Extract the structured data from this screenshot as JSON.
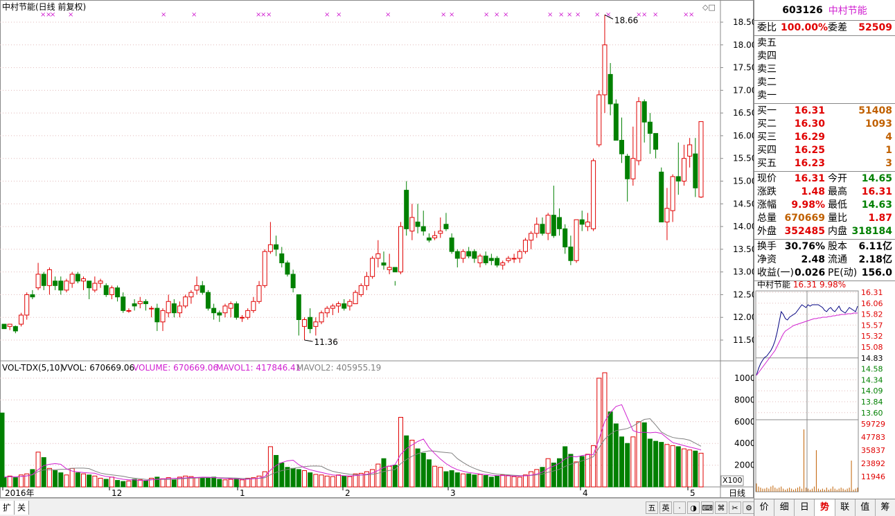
{
  "header": {
    "title": "中村节能(日线 前复权)"
  },
  "candles": [
    [
      11.85,
      11.85,
      11.75,
      11.75
    ],
    [
      11.8,
      11.85,
      11.72,
      11.85
    ],
    [
      11.8,
      11.82,
      11.65,
      11.7
    ],
    [
      11.85,
      12.1,
      11.8,
      12.05
    ],
    [
      12.05,
      12.55,
      11.95,
      12.5
    ],
    [
      12.5,
      12.6,
      12.4,
      12.45
    ],
    [
      12.65,
      13.2,
      12.6,
      12.95
    ],
    [
      12.95,
      13.0,
      12.6,
      12.7
    ],
    [
      12.7,
      13.1,
      12.5,
      13.05
    ],
    [
      12.7,
      12.9,
      12.6,
      12.8
    ],
    [
      12.8,
      12.9,
      12.5,
      12.6
    ],
    [
      12.6,
      12.85,
      12.55,
      12.8
    ],
    [
      12.75,
      13.0,
      12.65,
      12.95
    ],
    [
      12.95,
      13.0,
      12.75,
      12.8
    ],
    [
      12.8,
      12.9,
      12.6,
      12.85
    ],
    [
      12.8,
      12.8,
      12.4,
      12.65
    ],
    [
      12.6,
      12.9,
      12.55,
      12.75
    ],
    [
      12.75,
      12.85,
      12.65,
      12.8
    ],
    [
      12.7,
      12.75,
      12.45,
      12.5
    ],
    [
      12.5,
      12.7,
      12.4,
      12.65
    ],
    [
      12.65,
      12.7,
      12.35,
      12.45
    ],
    [
      12.45,
      12.55,
      12.1,
      12.15
    ],
    [
      12.15,
      12.2,
      12.1,
      12.15
    ],
    [
      12.3,
      12.4,
      12.15,
      12.25
    ],
    [
      12.3,
      12.45,
      12.2,
      12.35
    ],
    [
      12.35,
      12.4,
      12.15,
      12.3
    ],
    [
      12.2,
      12.25,
      12.0,
      12.2
    ],
    [
      12.2,
      12.3,
      11.7,
      11.9
    ],
    [
      11.9,
      12.2,
      11.7,
      12.15
    ],
    [
      12.1,
      12.5,
      12.0,
      12.35
    ],
    [
      12.3,
      12.4,
      12.0,
      12.1
    ],
    [
      12.1,
      12.35,
      12.0,
      12.25
    ],
    [
      12.25,
      12.5,
      12.2,
      12.45
    ],
    [
      12.45,
      12.6,
      12.3,
      12.55
    ],
    [
      12.6,
      12.9,
      12.5,
      12.7
    ],
    [
      12.7,
      12.8,
      12.5,
      12.55
    ],
    [
      12.55,
      12.6,
      12.15,
      12.2
    ],
    [
      12.2,
      12.3,
      11.95,
      12.1
    ],
    [
      12.1,
      12.15,
      11.9,
      12.05
    ],
    [
      12.1,
      12.3,
      12.0,
      12.25
    ],
    [
      12.2,
      12.35,
      12.0,
      12.3
    ],
    [
      12.3,
      12.35,
      11.95,
      12.0
    ],
    [
      12.0,
      12.05,
      11.9,
      12.0
    ],
    [
      12.0,
      12.2,
      11.95,
      12.15
    ],
    [
      12.15,
      12.45,
      12.1,
      12.35
    ],
    [
      12.35,
      12.8,
      12.3,
      12.7
    ],
    [
      12.7,
      13.5,
      12.65,
      13.45
    ],
    [
      13.45,
      14.1,
      13.4,
      13.6
    ],
    [
      13.6,
      13.8,
      13.35,
      13.5
    ],
    [
      13.4,
      13.55,
      13.1,
      13.2
    ],
    [
      13.2,
      13.25,
      12.9,
      12.95
    ],
    [
      12.95,
      13.05,
      12.55,
      12.65
    ],
    [
      12.5,
      12.5,
      11.6,
      11.95
    ],
    [
      11.8,
      12.0,
      11.5,
      11.95
    ],
    [
      12.0,
      12.2,
      11.65,
      11.75
    ],
    [
      11.8,
      12.0,
      11.6,
      11.9
    ],
    [
      11.9,
      12.15,
      11.85,
      12.1
    ],
    [
      12.1,
      12.25,
      12.0,
      12.2
    ],
    [
      12.2,
      12.3,
      12.05,
      12.25
    ],
    [
      12.25,
      12.35,
      12.1,
      12.3
    ],
    [
      12.3,
      12.4,
      12.15,
      12.2
    ],
    [
      12.25,
      12.4,
      12.15,
      12.35
    ],
    [
      12.3,
      12.6,
      12.3,
      12.55
    ],
    [
      12.5,
      12.75,
      12.45,
      12.7
    ],
    [
      12.7,
      13.0,
      12.6,
      12.9
    ],
    [
      12.9,
      13.35,
      12.85,
      13.3
    ],
    [
      13.3,
      13.7,
      13.1,
      13.4
    ],
    [
      13.2,
      13.45,
      13.05,
      13.15
    ],
    [
      13.05,
      13.4,
      12.95,
      13.1
    ],
    [
      13.1,
      12.8,
      12.7,
      13.0
    ],
    [
      13.0,
      14.1,
      12.95,
      14.0
    ],
    [
      14.8,
      15.0,
      13.8,
      13.95
    ],
    [
      13.9,
      14.5,
      13.7,
      14.2
    ],
    [
      14.1,
      14.5,
      13.85,
      14.0
    ],
    [
      14.0,
      14.35,
      13.8,
      13.9
    ],
    [
      13.75,
      13.85,
      13.65,
      13.7
    ],
    [
      13.75,
      13.9,
      13.7,
      13.8
    ],
    [
      13.85,
      14.2,
      13.75,
      13.9
    ],
    [
      14.05,
      14.3,
      13.9,
      13.95
    ],
    [
      13.75,
      13.85,
      13.4,
      13.45
    ],
    [
      13.45,
      13.5,
      13.1,
      13.3
    ],
    [
      13.3,
      13.5,
      13.2,
      13.45
    ],
    [
      13.45,
      13.55,
      13.3,
      13.35
    ],
    [
      13.45,
      13.5,
      13.2,
      13.3
    ],
    [
      13.2,
      13.4,
      13.1,
      13.35
    ],
    [
      13.35,
      13.45,
      13.15,
      13.2
    ],
    [
      13.3,
      13.4,
      13.15,
      13.25
    ],
    [
      13.3,
      13.35,
      13.1,
      13.15
    ],
    [
      13.15,
      13.25,
      13.05,
      13.2
    ],
    [
      13.25,
      13.35,
      13.2,
      13.3
    ],
    [
      13.3,
      13.4,
      13.2,
      13.3
    ],
    [
      13.3,
      13.5,
      13.2,
      13.45
    ],
    [
      13.45,
      13.75,
      13.4,
      13.7
    ],
    [
      13.7,
      13.9,
      13.5,
      13.85
    ],
    [
      13.85,
      14.2,
      13.75,
      14.05
    ],
    [
      14.05,
      14.2,
      13.8,
      13.85
    ],
    [
      13.85,
      14.3,
      13.7,
      14.25
    ],
    [
      14.25,
      14.9,
      13.75,
      13.8
    ],
    [
      14.2,
      14.4,
      13.8,
      13.95
    ],
    [
      13.95,
      14.05,
      13.4,
      13.55
    ],
    [
      13.55,
      13.8,
      13.15,
      13.25
    ],
    [
      13.25,
      14.0,
      13.2,
      14.15
    ],
    [
      14.15,
      14.35,
      13.9,
      14.05
    ],
    [
      14.0,
      14.3,
      13.9,
      14.1
    ],
    [
      13.95,
      15.5,
      13.9,
      15.45
    ],
    [
      15.8,
      17.0,
      15.75,
      16.9
    ],
    [
      16.9,
      18.66,
      16.5,
      18.0
    ],
    [
      17.35,
      17.6,
      16.45,
      16.7
    ],
    [
      16.7,
      16.8,
      16.1,
      15.9
    ],
    [
      15.9,
      16.4,
      15.4,
      15.6
    ],
    [
      15.55,
      15.6,
      14.55,
      15.05
    ],
    [
      15.05,
      16.2,
      14.9,
      15.5
    ],
    [
      15.45,
      16.85,
      15.35,
      16.75
    ],
    [
      16.75,
      16.8,
      15.85,
      16.3
    ],
    [
      16.3,
      16.5,
      15.6,
      16.05
    ],
    [
      16.05,
      16.0,
      15.5,
      15.7
    ],
    [
      15.2,
      15.3,
      14.1,
      14.1
    ],
    [
      14.1,
      14.85,
      13.7,
      14.4
    ],
    [
      14.35,
      15.15,
      14.1,
      15.1
    ],
    [
      15.1,
      15.85,
      14.7,
      15.0
    ],
    [
      15.0,
      15.8,
      14.9,
      15.5
    ],
    [
      15.55,
      15.95,
      15.3,
      15.8
    ],
    [
      15.6,
      15.95,
      14.65,
      14.85
    ],
    [
      14.65,
      16.31,
      14.63,
      16.31
    ]
  ],
  "candle_up": [
    0,
    1,
    0,
    1,
    1,
    0,
    1,
    0,
    1,
    0,
    0,
    1,
    1,
    0,
    1,
    0,
    1,
    1,
    0,
    1,
    0,
    0,
    1,
    0,
    1,
    0,
    1,
    0,
    1,
    1,
    0,
    1,
    1,
    1,
    1,
    0,
    0,
    0,
    0,
    1,
    1,
    0,
    1,
    1,
    1,
    1,
    1,
    1,
    0,
    0,
    0,
    0,
    0,
    1,
    0,
    1,
    1,
    1,
    1,
    1,
    0,
    1,
    1,
    1,
    1,
    1,
    1,
    0,
    1,
    0,
    1,
    0,
    1,
    0,
    0,
    0,
    1,
    1,
    0,
    0,
    0,
    1,
    0,
    0,
    1,
    0,
    0,
    0,
    1,
    1,
    1,
    1,
    1,
    1,
    1,
    0,
    1,
    0,
    0,
    0,
    0,
    1,
    0,
    1,
    1,
    1,
    1,
    0,
    0,
    0,
    0,
    1,
    1,
    0,
    0,
    0,
    0,
    1,
    1,
    0,
    1,
    1,
    0,
    1
  ],
  "volumes": [
    900,
    1000,
    850,
    1100,
    1200,
    1600,
    3200,
    2700,
    1700,
    1500,
    1300,
    1100,
    1700,
    1300,
    1200,
    1100,
    1000,
    800,
    700,
    900,
    600,
    500,
    550,
    700,
    650,
    550,
    800,
    900,
    750,
    850,
    650,
    900,
    1000,
    950,
    850,
    800,
    850,
    900,
    700,
    650,
    700,
    750,
    650,
    800,
    850,
    1000,
    1400,
    3700,
    2900,
    2200,
    1800,
    1700,
    1600,
    1500,
    1300,
    1150,
    1100,
    1000,
    950,
    1100,
    1000,
    950,
    1200,
    1250,
    1400,
    1600,
    2100,
    2600,
    1900,
    2000,
    6400,
    4700,
    4300,
    3500,
    3100,
    2500,
    1900,
    1800,
    1400,
    1500,
    1300,
    1200,
    1200,
    1100,
    1150,
    1050,
    900,
    1000,
    1100,
    1050,
    950,
    900,
    1100,
    1400,
    1600,
    1800,
    2600,
    2200,
    2600,
    3700,
    3000,
    2300,
    2800,
    3000,
    3800,
    10000,
    10500,
    6900,
    5800,
    4600,
    4000,
    4600,
    6000,
    5900,
    4400,
    4200,
    4100,
    3900,
    3800,
    3700,
    3500,
    3400,
    3300,
    3100,
    6800
  ],
  "price_axis": {
    "labels": [
      "18.50",
      "18.00",
      "17.50",
      "17.00",
      "16.50",
      "16.00",
      "15.50",
      "15.00",
      "14.50",
      "14.00",
      "13.50",
      "13.00",
      "12.50",
      "12.00",
      "11.50"
    ]
  },
  "volume_axis": {
    "labels": [
      "10000",
      "8000",
      "6000",
      "4000",
      "2000"
    ],
    "multiplier": "X100"
  },
  "date_axis": {
    "labels": [
      "2016年",
      "12",
      "1",
      "2",
      "3",
      "4",
      "5"
    ],
    "period": "日线"
  },
  "annotations": {
    "high": "18.66",
    "low": "11.36"
  },
  "indicator": {
    "name": "VOL-TDX(5,10)",
    "vvol": "VVOL: 670669.06",
    "volume": "VOLUME: 670669.06",
    "mavol1": "MAVOL1: 417846.41",
    "mavol2": "MAVOL2: 405955.19"
  },
  "bottom_tabs": [
    "扩展八",
    "关联报价"
  ],
  "ime_icons": [
    "五",
    "英",
    "·",
    "◑",
    "⌨",
    "⌘",
    "✂",
    "⚙",
    "▦"
  ],
  "quote": {
    "code": "603126",
    "name": "中村节能",
    "ratio": {
      "l1": "委比",
      "v1": "100.00%",
      "l2": "委差",
      "v2": "52509"
    },
    "sell": [
      {
        "label": "卖五",
        "price": "",
        "vol": ""
      },
      {
        "label": "卖四",
        "price": "",
        "vol": ""
      },
      {
        "label": "卖三",
        "price": "",
        "vol": ""
      },
      {
        "label": "卖二",
        "price": "",
        "vol": ""
      },
      {
        "label": "卖一",
        "price": "",
        "vol": ""
      }
    ],
    "buy": [
      {
        "label": "买一",
        "price": "16.31",
        "vol": "51408"
      },
      {
        "label": "买二",
        "price": "16.30",
        "vol": "1093"
      },
      {
        "label": "买三",
        "price": "16.29",
        "vol": "4"
      },
      {
        "label": "买四",
        "price": "16.25",
        "vol": "1"
      },
      {
        "label": "买五",
        "price": "16.23",
        "vol": "3"
      }
    ],
    "stats": [
      {
        "l1": "现价",
        "v1": "16.31",
        "c1": "red",
        "l2": "今开",
        "v2": "14.65",
        "c2": "green"
      },
      {
        "l1": "涨跌",
        "v1": "1.48",
        "c1": "red",
        "l2": "最高",
        "v2": "16.31",
        "c2": "red"
      },
      {
        "l1": "涨幅",
        "v1": "9.98%",
        "c1": "red",
        "l2": "最低",
        "v2": "14.63",
        "c2": "green"
      },
      {
        "l1": "总量",
        "v1": "670669",
        "c1": "orange",
        "l2": "量比",
        "v2": "1.87",
        "c2": "red"
      },
      {
        "l1": "外盘",
        "v1": "352485",
        "c1": "red",
        "l2": "内盘",
        "v2": "318184",
        "c2": "green"
      }
    ],
    "fundamentals": [
      {
        "l1": "换手",
        "v1": "30.76%",
        "l2": "股本",
        "v2": "6.11亿"
      },
      {
        "l1": "净资",
        "v1": "2.48",
        "l2": "流通",
        "v2": "2.18亿"
      },
      {
        "l1": "收益(一)",
        "v1": "0.026",
        "l2": "PE(动)",
        "v2": "156.0"
      }
    ]
  },
  "mini_chart": {
    "title_name": "中村节能",
    "title_price": "16.31",
    "title_pct": "9.98%",
    "price_labels": [
      {
        "t": "16.31",
        "c": "red"
      },
      {
        "t": "16.06",
        "c": "red"
      },
      {
        "t": "15.82",
        "c": "red"
      },
      {
        "t": "15.57",
        "c": "red"
      },
      {
        "t": "15.32",
        "c": "red"
      },
      {
        "t": "15.08",
        "c": "red"
      },
      {
        "t": "14.83",
        "c": "black"
      },
      {
        "t": "14.58",
        "c": "green"
      },
      {
        "t": "14.34",
        "c": "green"
      },
      {
        "t": "14.09",
        "c": "green"
      },
      {
        "t": "13.84",
        "c": "green"
      },
      {
        "t": "13.60",
        "c": "green"
      }
    ],
    "vol_labels": [
      "59729",
      "47783",
      "35837",
      "23892",
      "11946"
    ]
  },
  "right_tabs": [
    "价",
    "细",
    "日",
    "势",
    "联",
    "值",
    "筹"
  ],
  "right_tab_active": 3,
  "colors": {
    "up": "#e00000",
    "down": "#008000",
    "ma1": "#d020d0",
    "ma2": "#808080",
    "grid": "#e0b8b8"
  }
}
